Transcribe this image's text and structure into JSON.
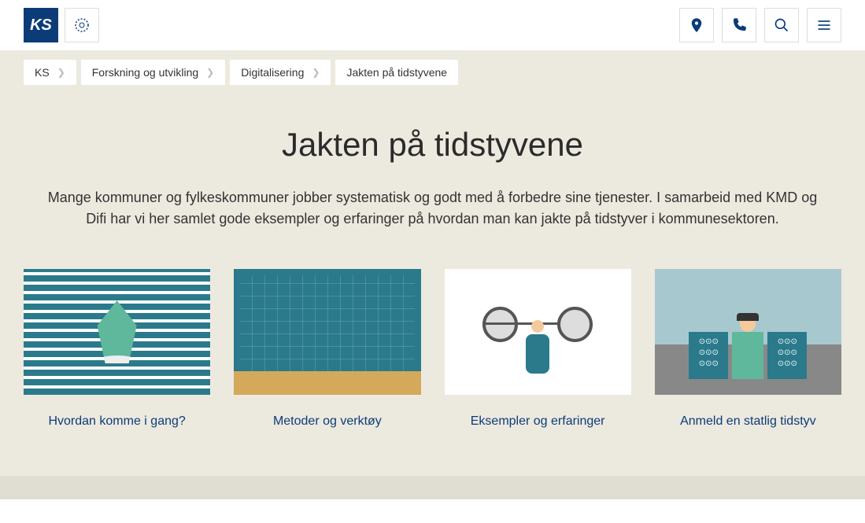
{
  "header": {
    "logo_text": "KS"
  },
  "breadcrumb": {
    "items": [
      {
        "label": "KS"
      },
      {
        "label": "Forskning og utvikling"
      },
      {
        "label": "Digitalisering"
      },
      {
        "label": "Jakten på tidstyvene"
      }
    ]
  },
  "main": {
    "title": "Jakten på tidstyvene",
    "intro": "Mange kommuner og fylkeskommuner jobber systematisk og godt med å forbedre sine tjenester. I samarbeid med KMD og Difi har vi her samlet gode eksempler og erfaringer på hvordan man kan jakte på tidstyver i kommunesektoren."
  },
  "cards": [
    {
      "label": "Hvordan komme i gang?"
    },
    {
      "label": "Metoder og verktøy"
    },
    {
      "label": "Eksempler og erfaringer"
    },
    {
      "label": "Anmeld en statlig tidstyv"
    }
  ]
}
